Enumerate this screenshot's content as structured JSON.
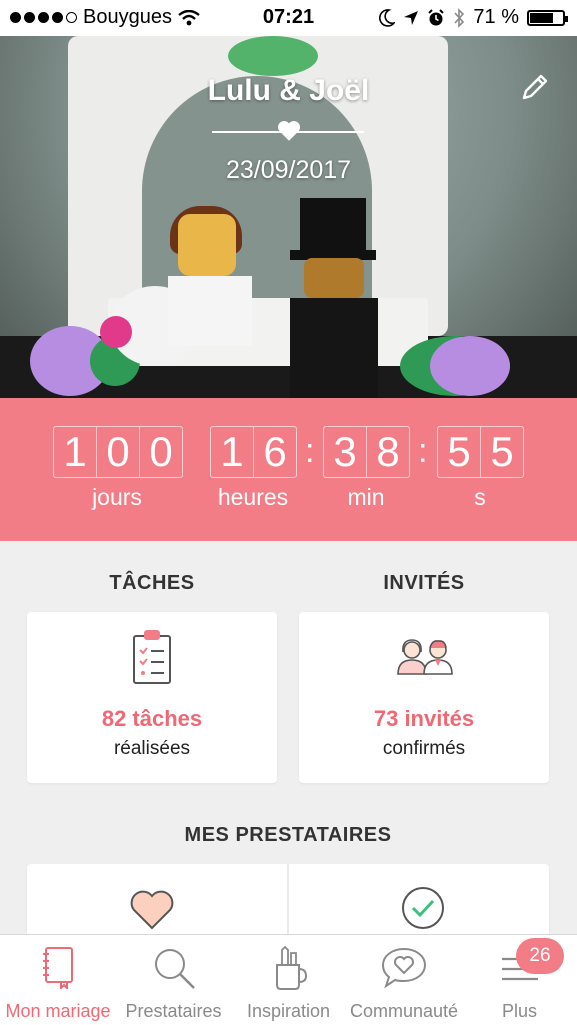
{
  "status_bar": {
    "carrier": "Bouygues",
    "time": "07:21",
    "battery": "71 %",
    "battery_level": 0.71,
    "icons": [
      "signal-dots-icon",
      "wifi-icon",
      "moon-icon",
      "location-arrow-icon",
      "alarm-icon",
      "bluetooth-icon",
      "battery-icon"
    ]
  },
  "hero": {
    "couple": "Lulu & Joël",
    "date": "23/09/2017",
    "edit_icon": "pencil-icon",
    "divider_icon": "heart-icon"
  },
  "countdown": {
    "days": [
      "1",
      "0",
      "0"
    ],
    "hours": [
      "1",
      "6"
    ],
    "minutes": [
      "3",
      "8"
    ],
    "seconds": [
      "5",
      "5"
    ],
    "separator": ":",
    "labels": {
      "days": "jours",
      "hours": "heures",
      "minutes": "min",
      "seconds": "s"
    }
  },
  "tasks": {
    "title": "TÂCHES",
    "count": "82 tâches",
    "subtitle": "réalisées",
    "icon": "clipboard-checklist-icon"
  },
  "guests": {
    "title": "INVITÉS",
    "count": "73 invités",
    "subtitle": "confirmés",
    "icon": "couple-people-icon"
  },
  "vendors": {
    "title": "MES PRESTATAIRES",
    "icons": [
      "heart-icon",
      "check-circle-icon"
    ]
  },
  "tabbar": {
    "items": [
      {
        "label": "Mon mariage",
        "icon": "notebook-icon",
        "active": true
      },
      {
        "label": "Prestataires",
        "icon": "search-icon",
        "active": false
      },
      {
        "label": "Inspiration",
        "icon": "pencil-cup-icon",
        "active": false
      },
      {
        "label": "Communauté",
        "icon": "chat-heart-icon",
        "active": false
      },
      {
        "label": "Plus",
        "icon": "menu-icon",
        "active": false
      }
    ],
    "badge": "26"
  },
  "colors": {
    "accent": "#f37d86",
    "accent_text": "#f06873",
    "background": "#efefef"
  }
}
